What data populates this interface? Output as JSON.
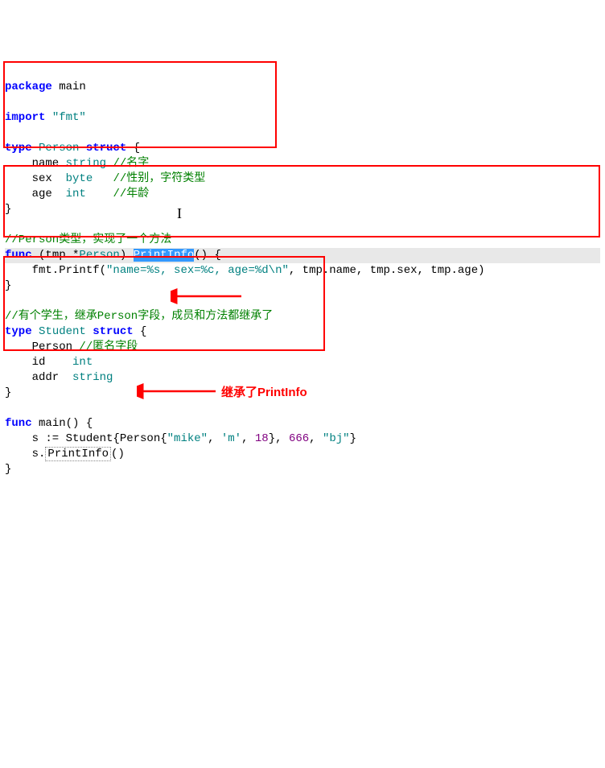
{
  "code": {
    "l1_kw_package": "package",
    "l1_ident": " main",
    "l3_kw_import": "import",
    "l3_str": " \"fmt\"",
    "l5_kw_type": "type",
    "l5_typ": " Person ",
    "l5_kw_struct": "struct",
    "l5_brace": " {",
    "l6_name": "    name ",
    "l6_typ": "string",
    "l6_cmt": " //名字",
    "l7_name": "    sex  ",
    "l7_typ": "byte",
    "l7_cmt": "   //性别，字符类型",
    "l8_name": "    age  ",
    "l8_typ": "int",
    "l8_cmt": "    //年龄",
    "l9_brace": "}",
    "l11_cmt": "//Person类型，实现了一个方法",
    "l12_kw_func": "func",
    "l12_recv": " (tmp *",
    "l12_typ": "Person",
    "l12_paren": ") ",
    "l12_method": "PrintInfo",
    "l12_sig": "() {",
    "l13_call": "    fmt.Printf(",
    "l13_str": "\"name=%s, sex=%c, age=%d\\n\"",
    "l13_args": ", tmp.name, tmp.sex, tmp.age)",
    "l14_brace": "}",
    "l16_cmt": "//有个学生，继承Person字段，成员和方法都继承了",
    "l17_kw_type": "type",
    "l17_typ": " Student ",
    "l17_kw_struct": "struct",
    "l17_brace": " {",
    "l18_field": "    Person ",
    "l18_cmt": "//匿名字段",
    "l19_name": "    id    ",
    "l19_typ": "int",
    "l20_name": "    addr  ",
    "l20_typ": "string",
    "l21_brace": "}",
    "l23_kw_func": "func",
    "l23_name": " main() {",
    "l24_a": "    s := Student{Person{",
    "l24_str1": "\"mike\"",
    "l24_c1": ", ",
    "l24_str2": "'m'",
    "l24_c2": ", ",
    "l24_num1": "18",
    "l24_c3": "}, ",
    "l24_num2": "666",
    "l24_c4": ", ",
    "l24_str3": "\"bj\"",
    "l24_end": "}",
    "l25_a": "    s.",
    "l25_method": "PrintInfo",
    "l25_b": "()",
    "l26_brace": "}"
  },
  "annotations": {
    "inherit_label": "继承了PrintInfo"
  }
}
